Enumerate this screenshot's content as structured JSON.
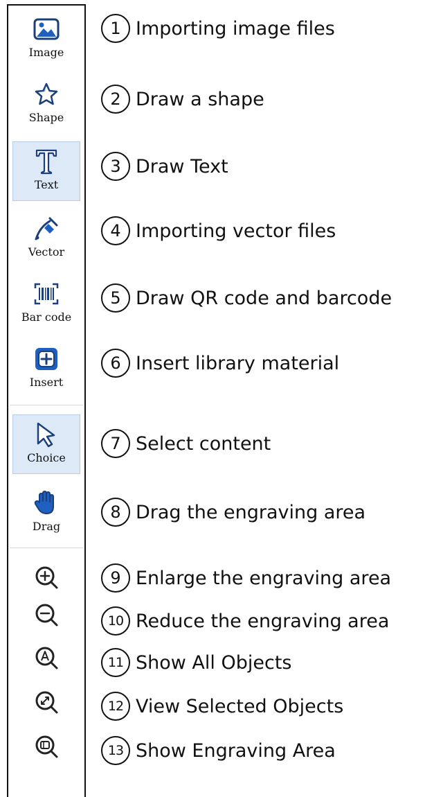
{
  "toolbar": {
    "tools": [
      {
        "label": "Image",
        "icon": "image-icon"
      },
      {
        "label": "Shape",
        "icon": "star-icon"
      },
      {
        "label": "Text",
        "icon": "text-icon"
      },
      {
        "label": "Vector",
        "icon": "vector-pen-icon"
      },
      {
        "label": "Bar code",
        "icon": "barcode-icon"
      },
      {
        "label": "Insert",
        "icon": "insert-plus-icon"
      },
      {
        "label": "Choice",
        "icon": "cursor-arrow-icon"
      },
      {
        "label": "Drag",
        "icon": "hand-icon"
      }
    ],
    "zoom_icons": [
      "zoom-in-icon",
      "zoom-out-icon",
      "zoom-all-icon",
      "zoom-selected-icon",
      "zoom-area-icon"
    ],
    "active_tools": [
      "Text",
      "Choice"
    ],
    "accent_color": "#1f5fbf"
  },
  "descriptions": [
    {
      "num": "1",
      "text": "Importing image files"
    },
    {
      "num": "2",
      "text": "Draw a shape"
    },
    {
      "num": "3",
      "text": "Draw Text"
    },
    {
      "num": "4",
      "text": "Importing vector files"
    },
    {
      "num": "5",
      "text": "Draw QR code and barcode"
    },
    {
      "num": "6",
      "text": "Insert library material"
    },
    {
      "num": "7",
      "text": "Select content"
    },
    {
      "num": "8",
      "text": "Drag the engraving area"
    },
    {
      "num": "9",
      "text": "Enlarge the engraving area"
    },
    {
      "num": "10",
      "text": "Reduce the engraving area"
    },
    {
      "num": "11",
      "text": "Show All Objects"
    },
    {
      "num": "12",
      "text": "View Selected Objects"
    },
    {
      "num": "13",
      "text": "Show Engraving Area"
    }
  ]
}
